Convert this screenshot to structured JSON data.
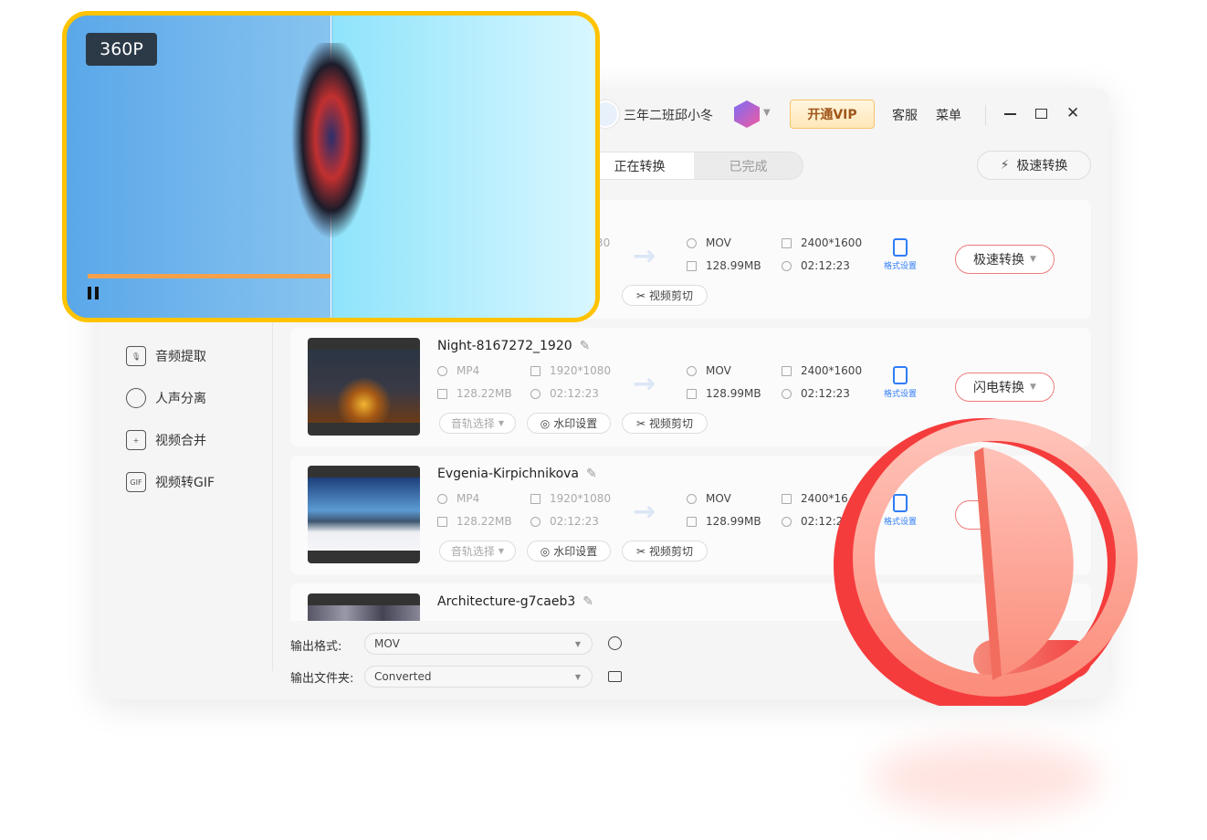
{
  "header": {
    "username": "三年二班邱小冬",
    "vip_label": "开通VIP",
    "service_label": "客服",
    "menu_label": "菜单"
  },
  "tabs": [
    {
      "label": "正在转换",
      "active": true
    },
    {
      "label": "已完成",
      "active": false
    }
  ],
  "fast_convert_label": "极速转换",
  "sidebar": {
    "items": [
      {
        "label": "音频提取",
        "icon": "microphone-icon"
      },
      {
        "label": "人声分离",
        "icon": "voice-separate-icon"
      },
      {
        "label": "视频合并",
        "icon": "merge-icon"
      },
      {
        "label": "视频转GIF",
        "icon": "gif-icon"
      }
    ]
  },
  "files": [
    {
      "name": "",
      "in_format": "",
      "in_res": "30",
      "in_size": "",
      "in_dur": "",
      "out_format": "MOV",
      "out_res": "2400*1600",
      "out_size": "128.99MB",
      "out_dur": "02:12:23",
      "convert_label": "极速转换"
    },
    {
      "name": "Night-8167272_1920",
      "in_format": "MP4",
      "in_res": "1920*1080",
      "in_size": "128.22MB",
      "in_dur": "02:12:23",
      "out_format": "MOV",
      "out_res": "2400*1600",
      "out_size": "128.99MB",
      "out_dur": "02:12:23",
      "convert_label": "闪电转换"
    },
    {
      "name": "Evgenia-Kirpichnikova",
      "in_format": "MP4",
      "in_res": "1920*1080",
      "in_size": "128.22MB",
      "in_dur": "02:12:23",
      "out_format": "MOV",
      "out_res": "2400*16",
      "out_size": "128.99MB",
      "out_dur": "02:12:2",
      "convert_label": ""
    },
    {
      "name": "Architecture-g7caeb3"
    }
  ],
  "file_actions": {
    "format_settings": "格式设置",
    "audio_track": "音轨选择",
    "watermark": "水印设置",
    "trim": "视频剪切"
  },
  "output": {
    "format_label": "输出格式:",
    "format_value": "MOV",
    "folder_label": "输出文件夹:",
    "folder_value": "Converted"
  },
  "preview": {
    "quality_badge": "360P",
    "progress": 0.45
  },
  "colors": {
    "accent": "#2f7cf6",
    "vip": "#ffc300",
    "danger": "#f24040"
  }
}
